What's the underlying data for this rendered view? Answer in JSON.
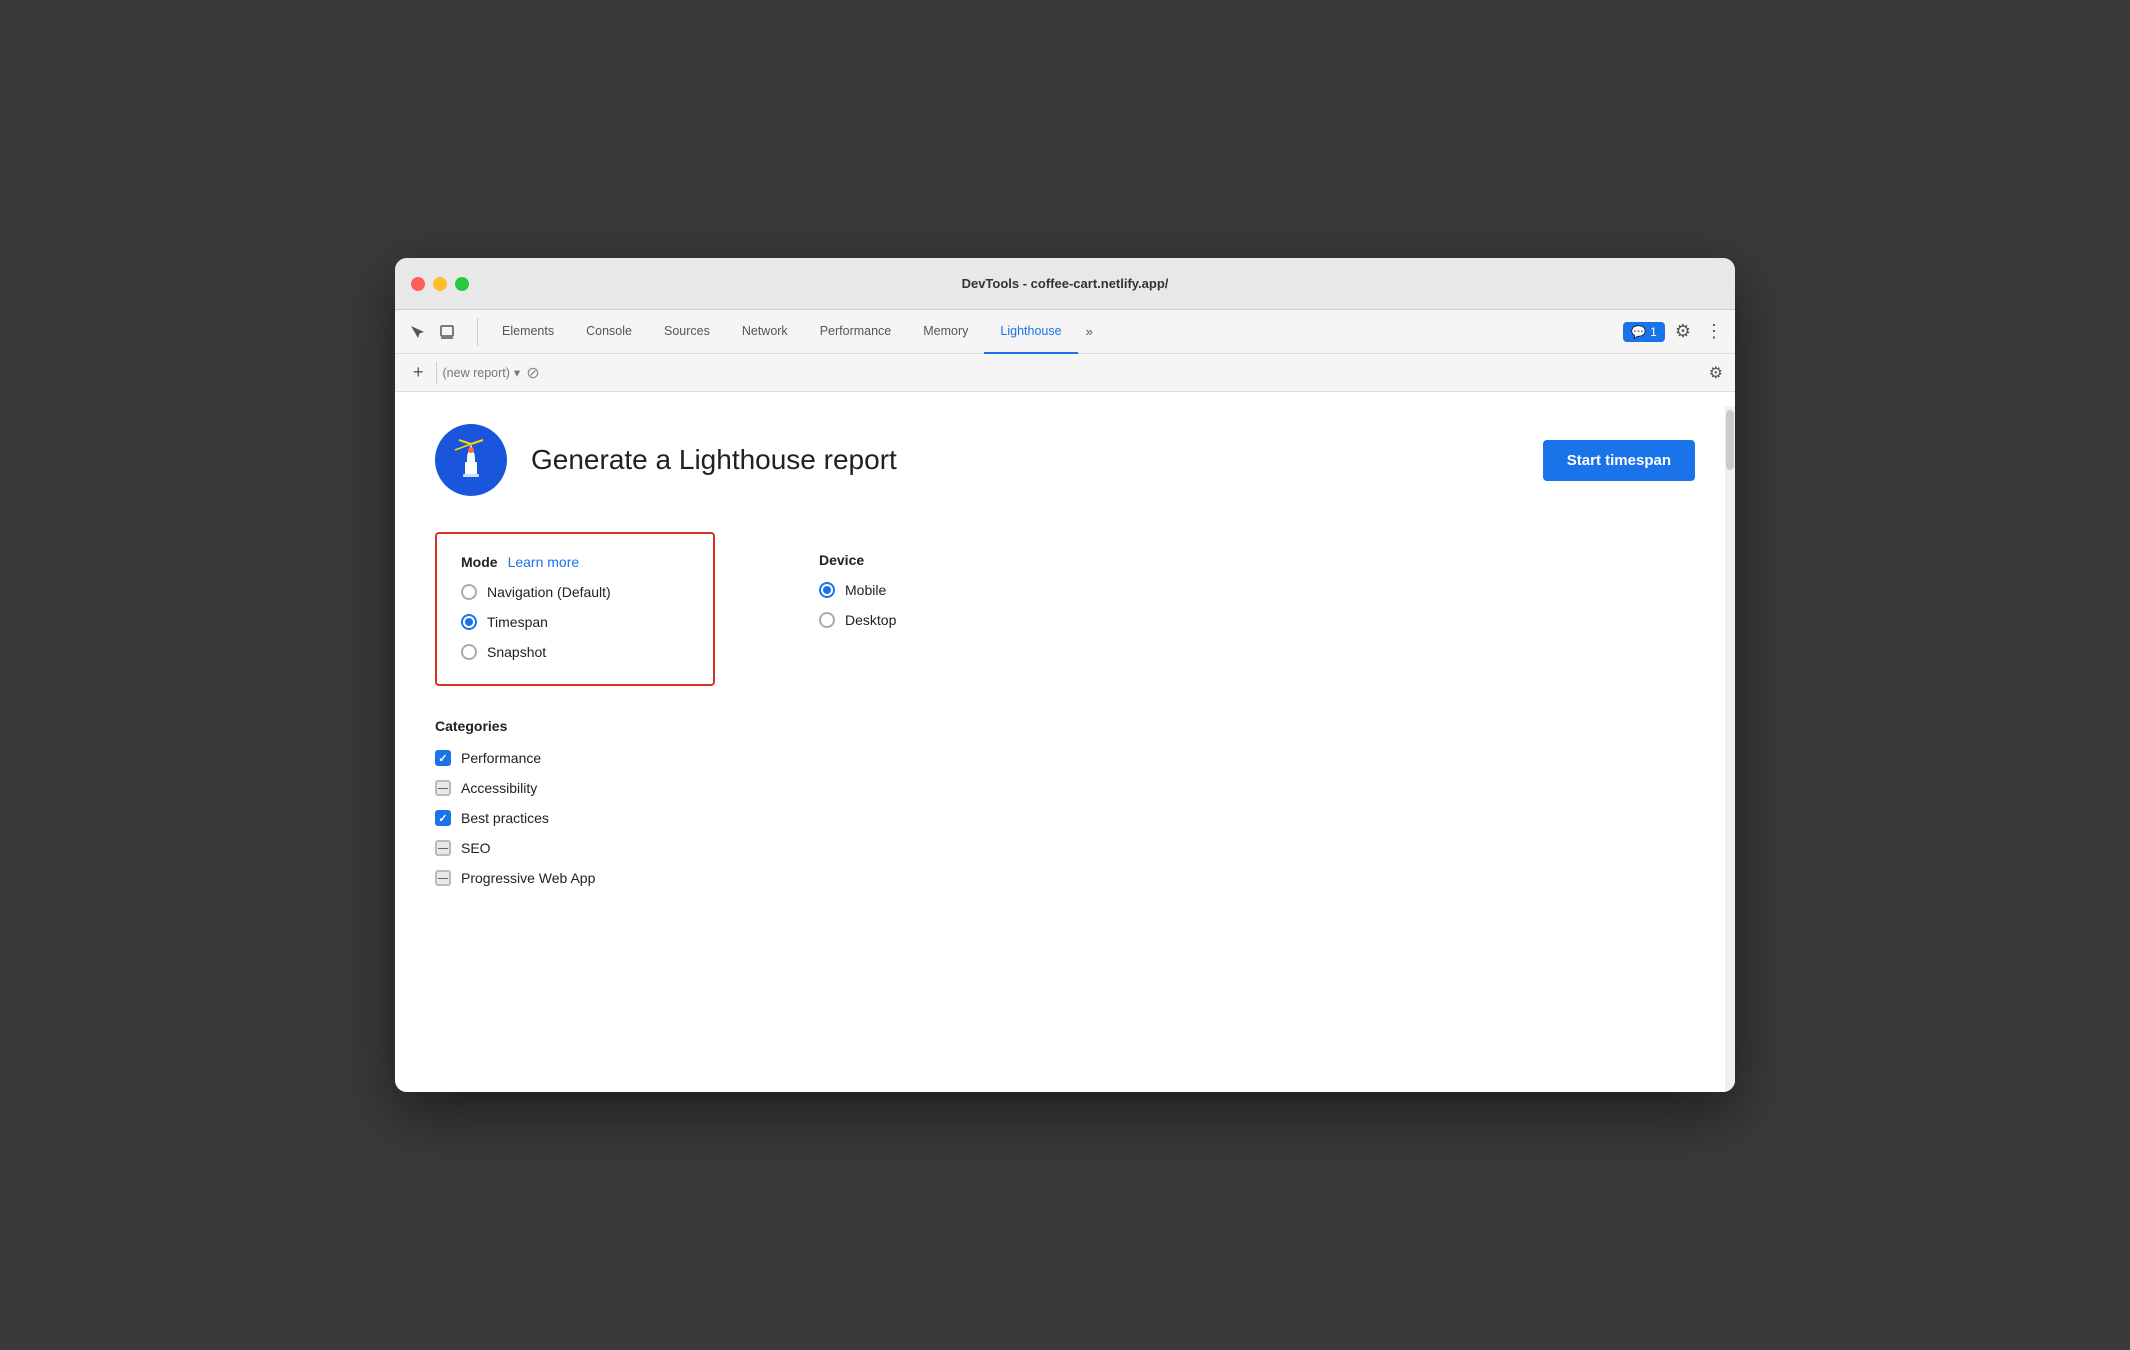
{
  "window": {
    "title": "DevTools - coffee-cart.netlify.app/"
  },
  "toolbar": {
    "tabs": [
      {
        "id": "elements",
        "label": "Elements",
        "active": false
      },
      {
        "id": "console",
        "label": "Console",
        "active": false
      },
      {
        "id": "sources",
        "label": "Sources",
        "active": false
      },
      {
        "id": "network",
        "label": "Network",
        "active": false
      },
      {
        "id": "performance",
        "label": "Performance",
        "active": false
      },
      {
        "id": "memory",
        "label": "Memory",
        "active": false
      },
      {
        "id": "lighthouse",
        "label": "Lighthouse",
        "active": true
      }
    ],
    "more_label": "»",
    "chat_badge": "1",
    "gear_icon": "⚙",
    "dots_icon": "⋮"
  },
  "report_bar": {
    "add_label": "+",
    "report_placeholder": "(new report)",
    "chevron_icon": "▾",
    "no_entry_icon": "⊘",
    "gear_icon": "⚙"
  },
  "header": {
    "title": "Generate a Lighthouse report",
    "start_button": "Start timespan"
  },
  "mode": {
    "section_title": "Mode",
    "learn_more_label": "Learn more",
    "options": [
      {
        "id": "navigation",
        "label": "Navigation (Default)",
        "checked": false
      },
      {
        "id": "timespan",
        "label": "Timespan",
        "checked": true
      },
      {
        "id": "snapshot",
        "label": "Snapshot",
        "checked": false
      }
    ]
  },
  "device": {
    "section_title": "Device",
    "options": [
      {
        "id": "mobile",
        "label": "Mobile",
        "checked": true
      },
      {
        "id": "desktop",
        "label": "Desktop",
        "checked": false
      }
    ]
  },
  "categories": {
    "section_title": "Categories",
    "items": [
      {
        "id": "performance",
        "label": "Performance",
        "state": "checked"
      },
      {
        "id": "accessibility",
        "label": "Accessibility",
        "state": "indeterminate"
      },
      {
        "id": "best-practices",
        "label": "Best practices",
        "state": "checked"
      },
      {
        "id": "seo",
        "label": "SEO",
        "state": "indeterminate"
      },
      {
        "id": "pwa",
        "label": "Progressive Web App",
        "state": "indeterminate"
      }
    ]
  },
  "colors": {
    "accent_blue": "#1a73e8",
    "red_border": "#d93025"
  }
}
